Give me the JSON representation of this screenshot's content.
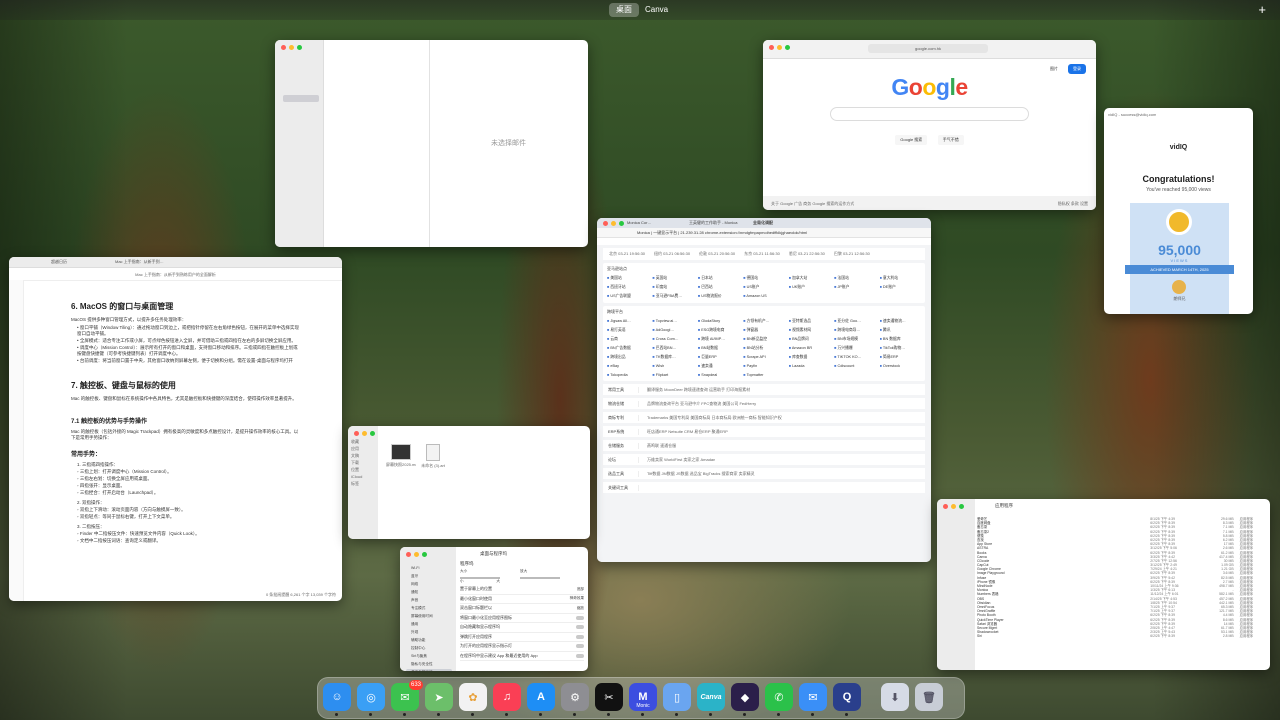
{
  "spaces": {
    "desktop": "桌面",
    "canva": "Canva"
  },
  "mail": {
    "empty": "未选择邮件",
    "sidebar": [
      "",
      "",
      "",
      "",
      "",
      "",
      "",
      "",
      "",
      "",
      "",
      "",
      "",
      "",
      "",
      "",
      "",
      "",
      "",
      "",
      "",
      "",
      "",
      ""
    ]
  },
  "google": {
    "url": "google.com.hk",
    "logo": [
      "G",
      "o",
      "o",
      "g",
      "l",
      "e"
    ],
    "logo_colors": [
      "#4285f4",
      "#ea4335",
      "#fbbc05",
      "#4285f4",
      "#34a853",
      "#ea4335"
    ],
    "btn_search": "Google 搜索",
    "btn_lucky": "手气不错",
    "signin": "登录",
    "top_links": "图片",
    "footer_left": "关于 Google  广告  商务  Google 搜索的运作方式",
    "footer_right": "隐私权  条款  设置"
  },
  "vidiq": {
    "sender": "vidIQ - success@vidiq.com",
    "logo": "vidIQ",
    "title": "Congratulations!",
    "subtitle": "You've reached 95,000 views",
    "number": "95,000",
    "views": "VIEWS",
    "ribbon": "ACHIEVED MARCH 14TH, 2025",
    "channel": "朗师兄"
  },
  "notes": {
    "tab1": "超越日历",
    "tab2": "Mac 上手指南：从新手到…",
    "title": "Mac 上手指南：从新手到熟练用户的全面解析",
    "h_window": "6. MacOS 的窗口与桌面管理",
    "p_window": "MacOS 提供多种窗口管理方式，以提升多任务处理效率：",
    "li_window": [
      "• 窗口平铺（Window Tiling）：通过拖动窗口到边上，或把指针停留在左右角绿色按钮，在展开的菜单中选择实现窗口自动平铺。",
      "• 全屏模式：适合专注工作或小屏，可点绿色按钮进入全屏，并可借助三指或四指在左右的多屏切换全屏应用。",
      "• 调度中心（Mission Control）：展示所有打开的窗口和桌面，支持窗口移动和排序。三指或四指在触控板上划或按键盘快捷键（可参考快捷键列表）打开调度中心。",
      "• 台前调度：将当前窗口置于中央，其他窗口收纳到屏幕左侧，便于切换和分组。需在设置-桌面与程序坞打开"
    ],
    "h_touch": "7. 触控板、键盘与鼠标的使用",
    "p_touch": "Mac 的触控板、键盘和鼠标在系统操作中各具特色，尤其是触控板和快捷键的深度结合，使得操作效率显著提升。",
    "h_touch2": "7.1 触控板的优势与手势操作",
    "p_touch2": "Mac 的触控板（包括外接的 Magic Trackpad）拥有极高的灵敏度和多点触控设计，是提升操作效率的核心工具。以下是常用手势操作：",
    "h_gesture": "常用手势：",
    "li_gesture": [
      "1. 三指或四指操作：",
      "   ◦ 三指上划：打开调度中心（Mission Control）。",
      "   ◦ 三指左右划：切换全屏应用或桌面。",
      "   ◦ 四指张开：显示桌面。",
      "   ◦ 三指捏合：打开启动台（Launchpad）。",
      "2. 双指操作：",
      "   ◦ 双指上下滑动：滚动页面内容（方向与触摸屏一致）。",
      "   ◦ 双指轻点：等同于鼠标右键，打开上下文菜单。",
      "3. 二指按压：",
      "   ◦ Finder 中二指按压文件：快速预览文件内容（Quick Look）。",
      "   ◦ 文档中二指按压词语：查询定义或翻译。"
    ],
    "status": "0 条批阅提醒    6,261 个字  13,039 个字符"
  },
  "monica": {
    "tabs": [
      "Monica Cor…",
      "王英健的工作助手 - Monica",
      "全局化调配"
    ],
    "url": "Monica | 一键显示平台 | 21.239.31.28   chrome-extension://nmdgfmpapmoihedffklkjghaeolok/html",
    "clocks": [
      "北京 03-21 19:56:30",
      "纽约 03-21 06:56:30",
      "伦敦 03-21 20:56:30",
      "东京 03-21 11:56:30",
      "悉尼 03-21 22:56:30",
      "巴黎 03-21 12:56:30"
    ],
    "section1": "亚马逊站点",
    "sites": [
      "美国站",
      "英国站",
      "日本站",
      "德国站",
      "加拿大站",
      "法国站",
      "意大利站",
      "西班牙站",
      "印度站",
      "巴西站",
      "US账户",
      "UK账户",
      "JP账户",
      "DE账户",
      "US广告联盟",
      "亚马逊FBA费…",
      "US物流报价",
      "Amazon US"
    ],
    "section2": "跨境平台",
    "platforms": [
      "Jigsaw All…",
      "Topview.ai…",
      "GlodaStory",
      "方领有机产…",
      "亚特斯选品",
      "亚分佐 Goo…",
      "速卖通物流…",
      "易打英语",
      "AdGoogl…",
      "ESG跨境电商",
      "弹窗器",
      "视频素材网",
      "跨境电商导…",
      "腾讯",
      "云商",
      "Cross Com…",
      "跨境 AI/IMP…",
      "BN新品监控",
      "BN品牌词",
      "BN市场规模",
      "BN 数据库",
      "BN广告数据",
      "巴西站BN…",
      "BN站数据",
      "BN站分析",
      "Amazon BR",
      "万兴播爆",
      "TikTok购物…",
      "跨境出品",
      "TK数据库…",
      "巨量ERP",
      "Scrape API",
      "库查数据",
      "TIKTOK KO…",
      "简易ERP",
      "eBay",
      "Wish",
      "速卖通",
      "Payfin",
      "Lazada",
      "Cdiscount",
      "Overstock",
      "Tokopedia",
      "Flipkart",
      "Snapdeal",
      "Topmatter"
    ],
    "rows": [
      {
        "k": "常用工具",
        "v": "翻译服务  MoonDeer  跨境速递查询  运营助手  打印海报素材"
      },
      {
        "k": "物流仓储",
        "v": "品牌物流查询平台  亚马逊中介  FPC查物流  美国公司 FedHerry"
      },
      {
        "k": "商标专利",
        "v": "Trademarks  美国专利局  美国商标局  日本商标局  欧洲统一商标  智能知识产权"
      },
      {
        "k": "ERP系统",
        "v": "旺店通ERP  Netsuite CRM  易仓ERP  聚通ERP"
      },
      {
        "k": "仓储服务",
        "v": "燕鸣联  速通仓服"
      },
      {
        "k": "论坛",
        "v": "万维卖家  WorldFirst  卖家之家  Amadan"
      },
      {
        "k": "选品工具",
        "v": "Tiff数据  JM数据  JS数据  选品宝 BigTracks  搜索商家  卖家精灵"
      },
      {
        "k": "关键词工具",
        "v": ""
      }
    ]
  },
  "finder_small": {
    "sidebar": [
      "收藏",
      "应用",
      "文稿",
      "下载",
      "位置",
      "iCloud",
      "标签",
      "",
      "",
      ""
    ],
    "files": [
      "屏幕快照2025.mov",
      "未命名 (3).art"
    ]
  },
  "settings": {
    "title": "桌面与程序坞",
    "sidebar": [
      "Wi-Fi",
      "蓝牙",
      "网络",
      "通知",
      "声音",
      "专注模式",
      "屏幕使用时间",
      "通用",
      "外观",
      "辅助功能",
      "控制中心",
      "Siri与聚焦",
      "隐私与安全性",
      "桌面与程序坞",
      "显示器",
      "墙纸"
    ],
    "section": "程序坞",
    "size_label": "大小",
    "magnify_label": "放大",
    "size_left": "小",
    "size_right": "大",
    "rows": [
      {
        "label": "置于屏幕上的位置",
        "value": "底部"
      },
      {
        "label": "最小化窗口时使用",
        "value": "神奇效果"
      },
      {
        "label": "双击窗口标题栏以",
        "value": "缩放"
      },
      {
        "label": "将窗口最小化至应用程序图标",
        "value": ""
      },
      {
        "label": "自动隐藏和显示程序坞",
        "value": ""
      },
      {
        "label": "弹跳打开应用程序",
        "value": ""
      },
      {
        "label": "为打开的应用程序显示指示灯",
        "value": ""
      },
      {
        "label": "在程序坞中显示建议 App 和最近使用的 App",
        "value": ""
      }
    ]
  },
  "apps": {
    "title": "应用程序",
    "rows": [
      {
        "n": "爱奇艺",
        "d": "8/1/25 下午 4:39",
        "s": "29.6 MB",
        "k": "应用程序"
      },
      {
        "n": "百度网盘",
        "d": "6/2/25 下午 8:39",
        "s": "8.3 MB",
        "k": "应用程序"
      },
      {
        "n": "备忘录",
        "d": "6/2/25 下午 8:39",
        "s": "7.1 MB",
        "k": "应用程序"
      },
      {
        "n": "备忘录2",
        "d": "6/2/25 下午 8:39",
        "s": "7.1 MB",
        "k": "应用程序"
      },
      {
        "n": "便笺",
        "d": "6/2/25 下午 8:39",
        "s": "5.8 MB",
        "k": "应用程序"
      },
      {
        "n": "查找",
        "d": "6/2/25 下午 8:39",
        "s": "6.2 MB",
        "k": "应用程序"
      },
      {
        "n": "App Store",
        "d": "6/2/25 下午 8:39",
        "s": "17 MB",
        "k": "应用程序"
      },
      {
        "n": "ASTRA",
        "d": "3/12/25 下午 5:06",
        "s": "2.6 MB",
        "k": "应用程序"
      },
      {
        "n": "Books",
        "d": "6/2/25 下午 8:39",
        "s": "61.2 MB",
        "k": "应用程序"
      },
      {
        "n": "Canva",
        "d": "3/3/25 下午 4:42",
        "s": "417.4 MB",
        "k": "应用程序"
      },
      {
        "n": "CDcode",
        "d": "2/7/25 下午 12:56",
        "s": "30 MB",
        "k": "应用程序"
      },
      {
        "n": "CapCut",
        "d": "3/12/25 下午 2:49",
        "s": "1.09 GB",
        "k": "应用程序"
      },
      {
        "n": "Google Chrome",
        "d": "7/29/24 上午 4:21",
        "s": "1.21 GB",
        "k": "应用程序"
      },
      {
        "n": "Image Playground",
        "d": "6/2/25 下午 8:39",
        "s": "3.6 MB",
        "k": "应用程序"
      },
      {
        "n": "Infuse",
        "d": "3/9/25 下午 5:42",
        "s": "82.5 MB",
        "k": "应用程序"
      },
      {
        "n": "iPhone 镜像",
        "d": "6/2/25 下午 8:39",
        "s": "2.7 MB",
        "k": "应用程序"
      },
      {
        "n": "MindNode",
        "d": "10/11/24 上午 9:36",
        "s": "498.7 MB",
        "k": "应用程序"
      },
      {
        "n": "Monica",
        "d": "1/3/25 下午 6:13",
        "s": "-",
        "k": "应用程序"
      },
      {
        "n": "Numbers 表格",
        "d": "11/12/24 上午 6:01",
        "s": "582.1 MB",
        "k": "应用程序"
      },
      {
        "n": "OBS",
        "d": "2/14/25 下午 4:53",
        "s": "457.2 MB",
        "k": "应用程序"
      },
      {
        "n": "Obsidian",
        "d": "1/8/25 下午 10:54",
        "s": "442.1 MB",
        "k": "应用程序"
      },
      {
        "n": "OmniFocus",
        "d": "7/1/25 上午 9:37",
        "s": "65.3 MB",
        "k": "应用程序"
      },
      {
        "n": "OmniGraffle",
        "d": "7/1/25 上午 9:37",
        "s": "121.7 MB",
        "k": "应用程序"
      },
      {
        "n": "Photo Booth",
        "d": "6/2/25 下午 8:39",
        "s": "4.4 MB",
        "k": "应用程序"
      },
      {
        "n": "QuickTime Player",
        "d": "6/2/25 下午 8:39",
        "s": "8.6 MB",
        "k": "应用程序"
      },
      {
        "n": "Safari 浏览器",
        "d": "6/2/25 下午 8:39",
        "s": "14 MB",
        "k": "应用程序"
      },
      {
        "n": "Secure Mgmt",
        "d": "2/5/25 上午 4:47",
        "s": "61.7 MB",
        "k": "应用程序"
      },
      {
        "n": "Shadowrocket",
        "d": "2/3/25 上午 5:43",
        "s": "53.1 MB",
        "k": "应用程序"
      },
      {
        "n": "Siri",
        "d": "6/2/25 下午 8:39",
        "s": "2.8 MB",
        "k": "应用程序"
      }
    ]
  },
  "dock": {
    "apps": [
      {
        "name": "finder",
        "glyph": "☺",
        "color": "#2d8ef0"
      },
      {
        "name": "safari",
        "glyph": "◎",
        "color": "#3a9ff5"
      },
      {
        "name": "messages",
        "glyph": "✉",
        "color": "#3cc24f",
        "badge": "633"
      },
      {
        "name": "maps",
        "glyph": "➤",
        "color": "#6cbf6a"
      },
      {
        "name": "photos",
        "glyph": "✿",
        "color": "#f2f2f2"
      },
      {
        "name": "music",
        "glyph": "♫",
        "color": "#fa3f55"
      },
      {
        "name": "app-store",
        "glyph": "A",
        "color": "#1e8ef5"
      },
      {
        "name": "system-settings",
        "glyph": "⚙",
        "color": "#8e8e93"
      },
      {
        "name": "capcut",
        "glyph": "✂",
        "color": "#111111"
      },
      {
        "name": "monica",
        "glyph": "M",
        "color": "#3c4ee0",
        "label": "Monic"
      },
      {
        "name": "iphone-mirroring",
        "glyph": "▯",
        "color": "#6aa5f0"
      },
      {
        "name": "canva",
        "glyph": "Canva",
        "color": "#2bb3c8"
      },
      {
        "name": "obsidian",
        "glyph": "◆",
        "color": "#2b1f4a"
      },
      {
        "name": "wechat",
        "glyph": "✆",
        "color": "#2bc14a"
      },
      {
        "name": "mail",
        "glyph": "✉",
        "color": "#3a8ff7"
      },
      {
        "name": "quicktime",
        "glyph": "Q",
        "color": "#2a3f8c"
      },
      {
        "name": "downloads",
        "glyph": "⬇",
        "color": "#d6dbe6"
      },
      {
        "name": "trash",
        "glyph": "🗑",
        "color": "#c8cdd6"
      }
    ]
  }
}
